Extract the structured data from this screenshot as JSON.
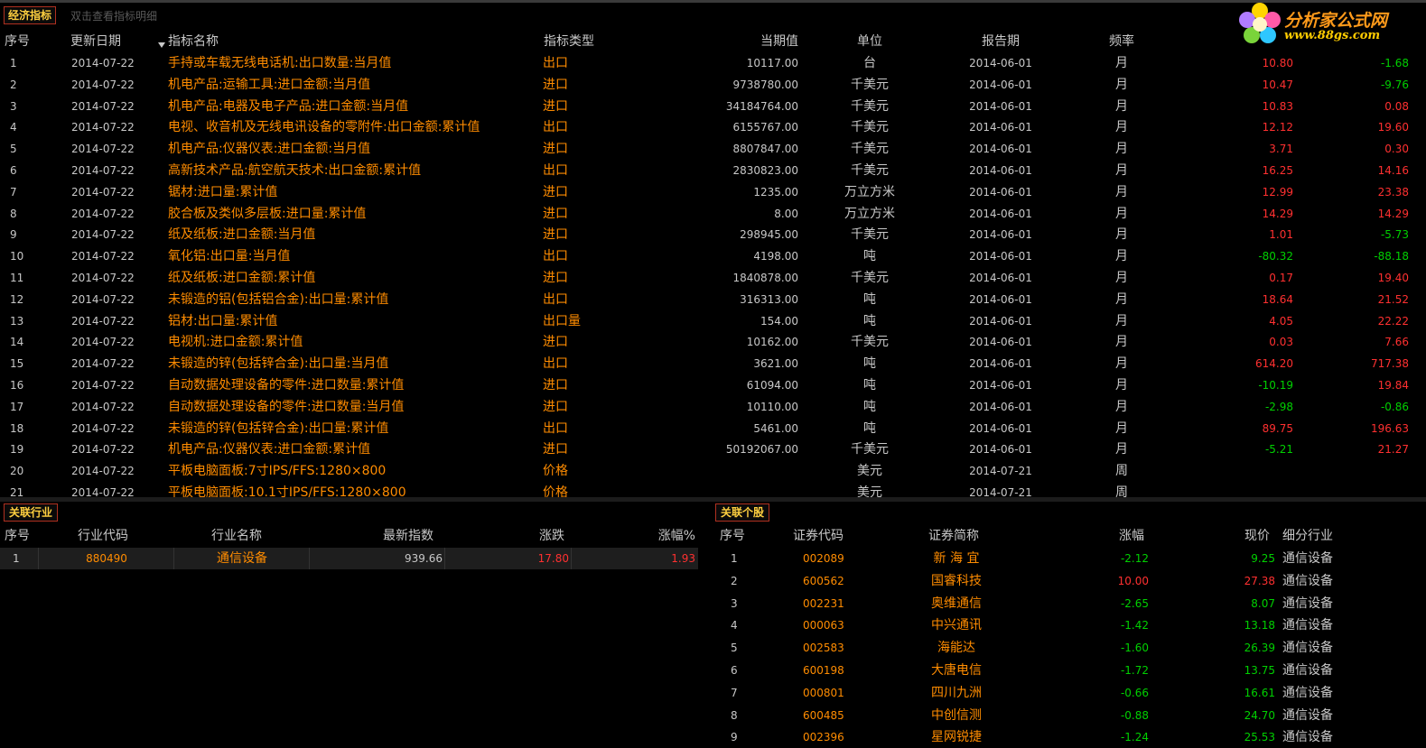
{
  "top": {
    "tab_label": "经济指标",
    "hint": "双击查看指标明细",
    "logo_line1": "分析家公式网",
    "logo_line2": "www.88gs.com"
  },
  "indicators": {
    "headers": [
      "序号",
      "更新日期",
      "指标名称",
      "指标类型",
      "当期值",
      "单位",
      "报告期",
      "频率"
    ],
    "rows": [
      {
        "n": "1",
        "date": "2014-07-22",
        "name": "手持或车载无线电话机:出口数量:当月值",
        "type": "出口",
        "value": "10117.00",
        "unit": "台",
        "period": "2014-06-01",
        "freq": "月",
        "c1": "10.80",
        "c2": "-1.68"
      },
      {
        "n": "2",
        "date": "2014-07-22",
        "name": "机电产品:运输工具:进口金额:当月值",
        "type": "进口",
        "value": "9738780.00",
        "unit": "千美元",
        "period": "2014-06-01",
        "freq": "月",
        "c1": "10.47",
        "c2": "-9.76"
      },
      {
        "n": "3",
        "date": "2014-07-22",
        "name": "机电产品:电器及电子产品:进口金额:当月值",
        "type": "进口",
        "value": "34184764.00",
        "unit": "千美元",
        "period": "2014-06-01",
        "freq": "月",
        "c1": "10.83",
        "c2": "0.08"
      },
      {
        "n": "4",
        "date": "2014-07-22",
        "name": "电视、收音机及无线电讯设备的零附件:出口金额:累计值",
        "type": "出口",
        "value": "6155767.00",
        "unit": "千美元",
        "period": "2014-06-01",
        "freq": "月",
        "c1": "12.12",
        "c2": "19.60"
      },
      {
        "n": "5",
        "date": "2014-07-22",
        "name": "机电产品:仪器仪表:进口金额:当月值",
        "type": "进口",
        "value": "8807847.00",
        "unit": "千美元",
        "period": "2014-06-01",
        "freq": "月",
        "c1": "3.71",
        "c2": "0.30"
      },
      {
        "n": "6",
        "date": "2014-07-22",
        "name": "高新技术产品:航空航天技术:出口金额:累计值",
        "type": "出口",
        "value": "2830823.00",
        "unit": "千美元",
        "period": "2014-06-01",
        "freq": "月",
        "c1": "16.25",
        "c2": "14.16"
      },
      {
        "n": "7",
        "date": "2014-07-22",
        "name": "锯材:进口量:累计值",
        "type": "进口",
        "value": "1235.00",
        "unit": "万立方米",
        "period": "2014-06-01",
        "freq": "月",
        "c1": "12.99",
        "c2": "23.38"
      },
      {
        "n": "8",
        "date": "2014-07-22",
        "name": "胶合板及类似多层板:进口量:累计值",
        "type": "进口",
        "value": "8.00",
        "unit": "万立方米",
        "period": "2014-06-01",
        "freq": "月",
        "c1": "14.29",
        "c2": "14.29"
      },
      {
        "n": "9",
        "date": "2014-07-22",
        "name": "纸及纸板:进口金额:当月值",
        "type": "进口",
        "value": "298945.00",
        "unit": "千美元",
        "period": "2014-06-01",
        "freq": "月",
        "c1": "1.01",
        "c2": "-5.73"
      },
      {
        "n": "10",
        "date": "2014-07-22",
        "name": "氧化铝:出口量:当月值",
        "type": "出口",
        "value": "4198.00",
        "unit": "吨",
        "period": "2014-06-01",
        "freq": "月",
        "c1": "-80.32",
        "c2": "-88.18"
      },
      {
        "n": "11",
        "date": "2014-07-22",
        "name": "纸及纸板:进口金额:累计值",
        "type": "进口",
        "value": "1840878.00",
        "unit": "千美元",
        "period": "2014-06-01",
        "freq": "月",
        "c1": "0.17",
        "c2": "19.40"
      },
      {
        "n": "12",
        "date": "2014-07-22",
        "name": "未锻造的铝(包括铝合金):出口量:累计值",
        "type": "出口",
        "value": "316313.00",
        "unit": "吨",
        "period": "2014-06-01",
        "freq": "月",
        "c1": "18.64",
        "c2": "21.52"
      },
      {
        "n": "13",
        "date": "2014-07-22",
        "name": "铝材:出口量:累计值",
        "type": "出口量",
        "value": "154.00",
        "unit": "吨",
        "period": "2014-06-01",
        "freq": "月",
        "c1": "4.05",
        "c2": "22.22"
      },
      {
        "n": "14",
        "date": "2014-07-22",
        "name": "电视机:进口金额:累计值",
        "type": "进口",
        "value": "10162.00",
        "unit": "千美元",
        "period": "2014-06-01",
        "freq": "月",
        "c1": "0.03",
        "c2": "7.66"
      },
      {
        "n": "15",
        "date": "2014-07-22",
        "name": "未锻造的锌(包括锌合金):出口量:当月值",
        "type": "出口",
        "value": "3621.00",
        "unit": "吨",
        "period": "2014-06-01",
        "freq": "月",
        "c1": "614.20",
        "c2": "717.38"
      },
      {
        "n": "16",
        "date": "2014-07-22",
        "name": "自动数据处理设备的零件:进口数量:累计值",
        "type": "进口",
        "value": "61094.00",
        "unit": "吨",
        "period": "2014-06-01",
        "freq": "月",
        "c1": "-10.19",
        "c2": "19.84"
      },
      {
        "n": "17",
        "date": "2014-07-22",
        "name": "自动数据处理设备的零件:进口数量:当月值",
        "type": "进口",
        "value": "10110.00",
        "unit": "吨",
        "period": "2014-06-01",
        "freq": "月",
        "c1": "-2.98",
        "c2": "-0.86"
      },
      {
        "n": "18",
        "date": "2014-07-22",
        "name": "未锻造的锌(包括锌合金):出口量:累计值",
        "type": "出口",
        "value": "5461.00",
        "unit": "吨",
        "period": "2014-06-01",
        "freq": "月",
        "c1": "89.75",
        "c2": "196.63"
      },
      {
        "n": "19",
        "date": "2014-07-22",
        "name": "机电产品:仪器仪表:进口金额:累计值",
        "type": "进口",
        "value": "50192067.00",
        "unit": "千美元",
        "period": "2014-06-01",
        "freq": "月",
        "c1": "-5.21",
        "c2": "21.27"
      },
      {
        "n": "20",
        "date": "2014-07-22",
        "name": "平板电脑面板:7寸IPS/FFS:1280×800",
        "type": "价格",
        "value": "",
        "unit": "美元",
        "period": "2014-07-21",
        "freq": "周",
        "c1": "",
        "c2": ""
      },
      {
        "n": "21",
        "date": "2014-07-22",
        "name": "平板电脑面板:10.1寸IPS/FFS:1280×800",
        "type": "价格",
        "value": "",
        "unit": "美元",
        "period": "2014-07-21",
        "freq": "周",
        "c1": "",
        "c2": ""
      }
    ]
  },
  "industry": {
    "tab_label": "关联行业",
    "headers": [
      "序号",
      "行业代码",
      "行业名称",
      "最新指数",
      "涨跌",
      "涨幅%"
    ],
    "rows": [
      {
        "n": "1",
        "code": "880490",
        "name": "通信设备",
        "index": "939.66",
        "chg": "17.80",
        "pct": "1.93"
      }
    ]
  },
  "stocks": {
    "tab_label": "关联个股",
    "headers": [
      "序号",
      "证券代码",
      "证券简称",
      "涨幅",
      "现价",
      "细分行业"
    ],
    "rows": [
      {
        "n": "1",
        "code": "002089",
        "name": "新 海 宜",
        "pct": "-2.12",
        "price": "9.25",
        "ind": "通信设备"
      },
      {
        "n": "2",
        "code": "600562",
        "name": "国睿科技",
        "pct": "10.00",
        "price": "27.38",
        "ind": "通信设备"
      },
      {
        "n": "3",
        "code": "002231",
        "name": "奥维通信",
        "pct": "-2.65",
        "price": "8.07",
        "ind": "通信设备"
      },
      {
        "n": "4",
        "code": "000063",
        "name": "中兴通讯",
        "pct": "-1.42",
        "price": "13.18",
        "ind": "通信设备"
      },
      {
        "n": "5",
        "code": "002583",
        "name": "海能达",
        "pct": "-1.60",
        "price": "26.39",
        "ind": "通信设备"
      },
      {
        "n": "6",
        "code": "600198",
        "name": "大唐电信",
        "pct": "-1.72",
        "price": "13.75",
        "ind": "通信设备"
      },
      {
        "n": "7",
        "code": "000801",
        "name": "四川九洲",
        "pct": "-0.66",
        "price": "16.61",
        "ind": "通信设备"
      },
      {
        "n": "8",
        "code": "600485",
        "name": "中创信测",
        "pct": "-0.88",
        "price": "24.70",
        "ind": "通信设备"
      },
      {
        "n": "9",
        "code": "002396",
        "name": "星网锐捷",
        "pct": "-1.24",
        "price": "25.53",
        "ind": "通信设备"
      }
    ]
  },
  "colors": {
    "up": "#ff3030",
    "down": "#00d000",
    "name": "#ff8c00",
    "accent_border": "#b03020",
    "tab_text": "#ffd040"
  }
}
